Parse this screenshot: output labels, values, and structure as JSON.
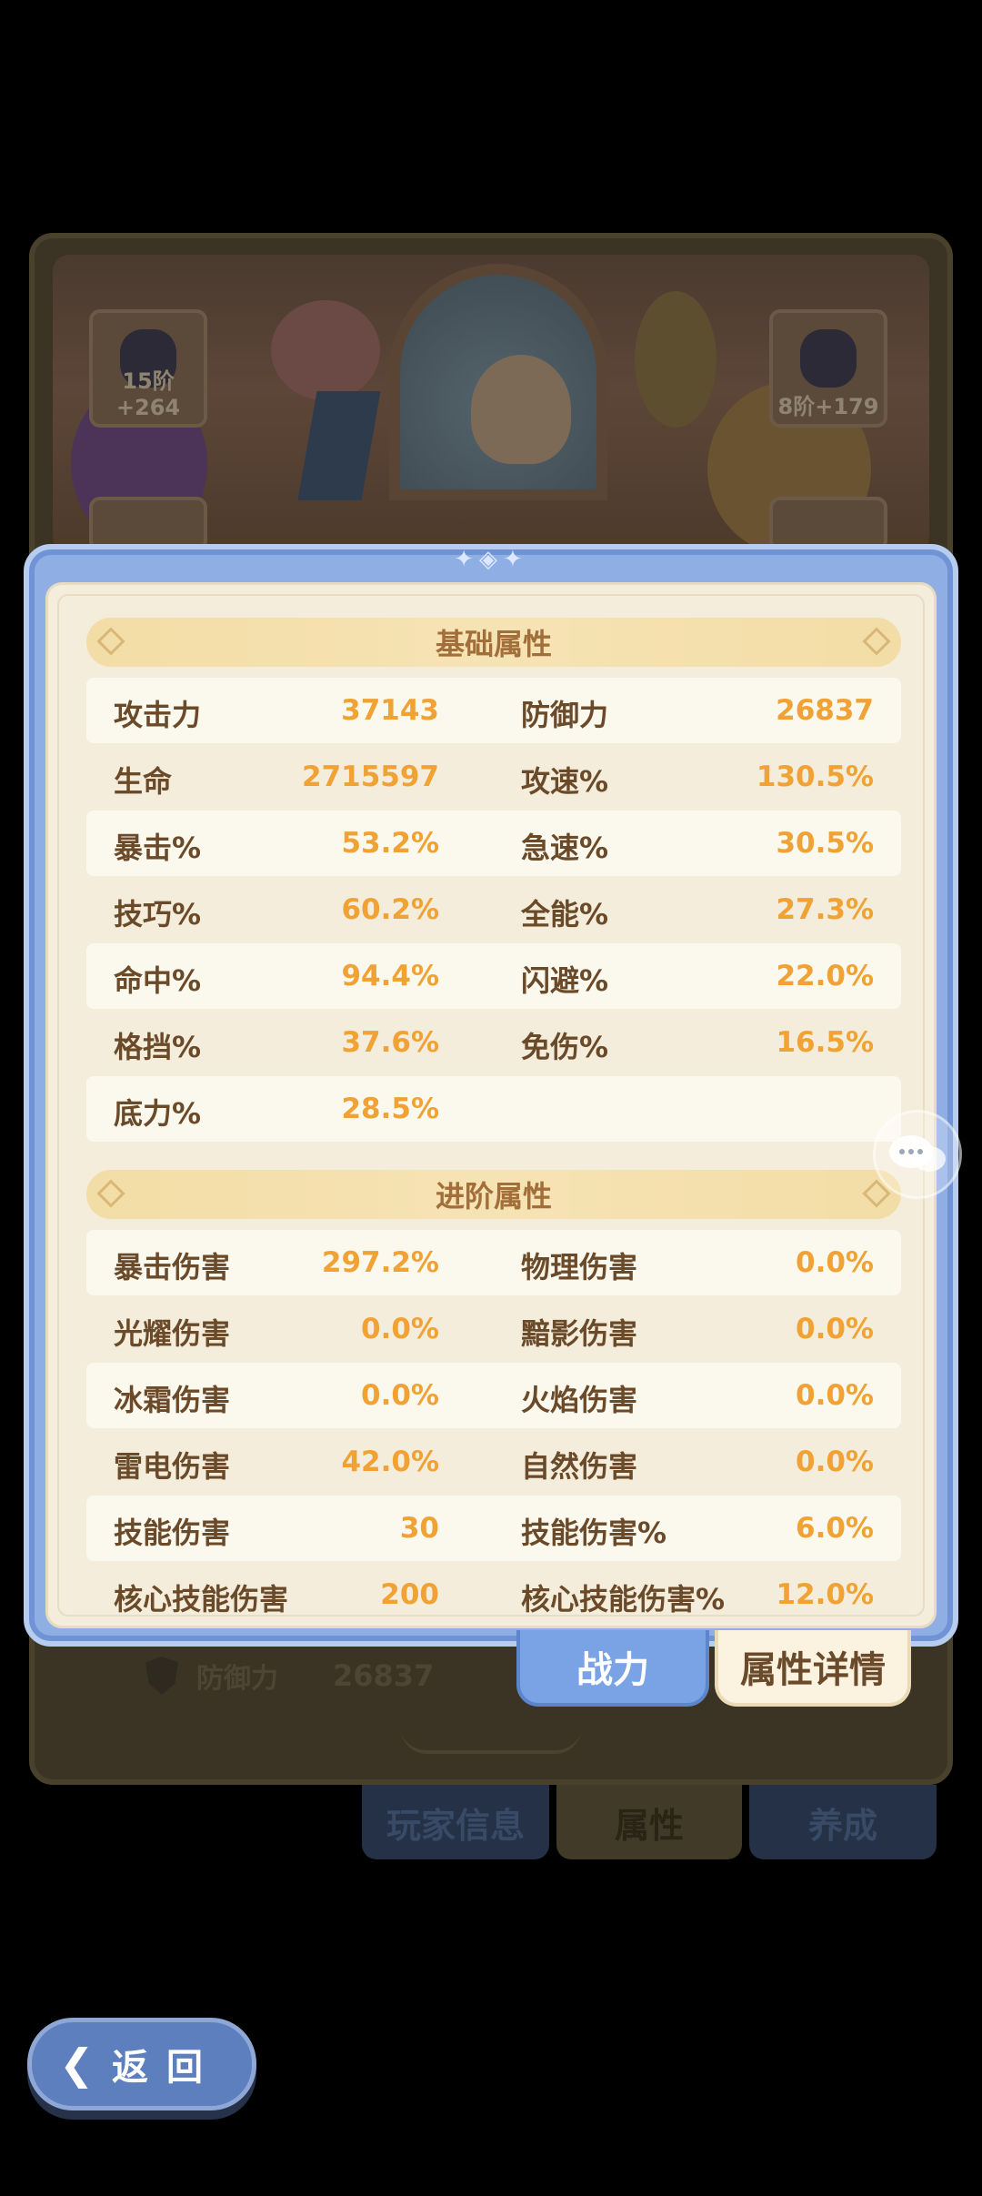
{
  "background": {
    "equip_slots": [
      {
        "level": "15阶+264"
      },
      {
        "level": "8阶+179"
      }
    ],
    "defense_label": "防御力",
    "defense_value": "26837",
    "bottom_tabs": [
      "玩家信息",
      "属性",
      "养成"
    ]
  },
  "panel": {
    "sections": [
      {
        "title": "基础属性",
        "rows": [
          [
            {
              "name": "攻击力",
              "value": "37143"
            },
            {
              "name": "防御力",
              "value": "26837"
            }
          ],
          [
            {
              "name": "生命",
              "value": "2715597"
            },
            {
              "name": "攻速%",
              "value": "130.5%"
            }
          ],
          [
            {
              "name": "暴击%",
              "value": "53.2%"
            },
            {
              "name": "急速%",
              "value": "30.5%"
            }
          ],
          [
            {
              "name": "技巧%",
              "value": "60.2%"
            },
            {
              "name": "全能%",
              "value": "27.3%"
            }
          ],
          [
            {
              "name": "命中%",
              "value": "94.4%"
            },
            {
              "name": "闪避%",
              "value": "22.0%"
            }
          ],
          [
            {
              "name": "格挡%",
              "value": "37.6%"
            },
            {
              "name": "免伤%",
              "value": "16.5%"
            }
          ],
          [
            {
              "name": "底力%",
              "value": "28.5%"
            },
            {
              "name": "",
              "value": ""
            }
          ]
        ]
      },
      {
        "title": "进阶属性",
        "rows": [
          [
            {
              "name": "暴击伤害",
              "value": "297.2%"
            },
            {
              "name": "物理伤害",
              "value": "0.0%"
            }
          ],
          [
            {
              "name": "光耀伤害",
              "value": "0.0%"
            },
            {
              "name": "黯影伤害",
              "value": "0.0%"
            }
          ],
          [
            {
              "name": "冰霜伤害",
              "value": "0.0%"
            },
            {
              "name": "火焰伤害",
              "value": "0.0%"
            }
          ],
          [
            {
              "name": "雷电伤害",
              "value": "42.0%"
            },
            {
              "name": "自然伤害",
              "value": "0.0%"
            }
          ],
          [
            {
              "name": "技能伤害",
              "value": "30"
            },
            {
              "name": "技能伤害%",
              "value": "6.0%"
            }
          ],
          [
            {
              "name": "核心技能伤害",
              "value": "200"
            },
            {
              "name": "核心技能伤害%",
              "value": "12.0%"
            }
          ]
        ]
      }
    ],
    "tabs": [
      "战力",
      "属性详情"
    ]
  },
  "back_button": {
    "label": "返回"
  },
  "colors": {
    "accent_blue": "#8eaee4",
    "stat_value": "#f0a235",
    "stat_name": "#6b4a2a",
    "section_header": "#f3dda6"
  }
}
